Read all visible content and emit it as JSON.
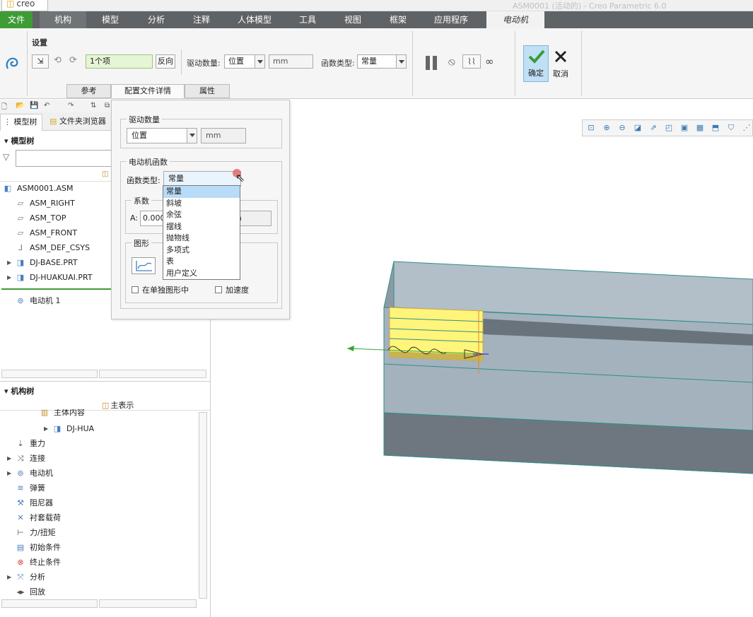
{
  "window": {
    "app_logo": "creo",
    "title": "ASM0001 (活动的) - Creo Parametric 6.0"
  },
  "menu": {
    "file": "文件",
    "items": [
      "机构",
      "模型",
      "分析",
      "注释",
      "人体模型",
      "工具",
      "视图",
      "框架",
      "应用程序"
    ],
    "active": "电动机"
  },
  "ribbon": {
    "group_settings": "设置",
    "reference_value": "1个项",
    "flip_button": "反向",
    "drive_qty_label": "驱动数量:",
    "drive_qty_value": "位置",
    "unit_value": "mm",
    "func_type_label": "函数类型:",
    "func_type_value": "常量",
    "ok_label": "确定",
    "cancel_label": "取消",
    "tabs": [
      "参考",
      "配置文件详情",
      "属性"
    ]
  },
  "left_panel": {
    "tab_model_tree": "模型树",
    "tab_folder_browser": "文件夹浏览器",
    "model_tree_title": "模型树",
    "model_tree_items": [
      "ASM0001.ASM",
      "ASM_RIGHT",
      "ASM_TOP",
      "ASM_FRONT",
      "ASM_DEF_CSYS",
      "DJ-BASE.PRT",
      "DJ-HUAKUAI.PRT",
      "电动机 1"
    ],
    "mech_tree_title": "机构树",
    "main_rep": "主表示",
    "mech_items": [
      "主体内容",
      "DJ-HUA",
      "重力",
      "连接",
      "电动机",
      "弹簧",
      "阻尼器",
      "衬套载荷",
      "力/扭矩",
      "初始条件",
      "终止条件",
      "分析",
      "回放"
    ]
  },
  "popup": {
    "drive_qty_group": "驱动数量",
    "drive_qty_value": "位置",
    "drive_qty_unit": "mm",
    "motor_func_group": "电动机函数",
    "func_type_label": "函数类型:",
    "func_type_value": "常量",
    "coeff_group": "系数",
    "coeff_a_label": "A:",
    "coeff_a_value": "0.000",
    "coeff_unit": "n",
    "graph_group": "图形",
    "separate_graph": "在单独图形中",
    "acceleration": "加速度",
    "dropdown_options": [
      "常量",
      "斜坡",
      "余弦",
      "摆线",
      "抛物线",
      "多项式",
      "表",
      "用户定义"
    ]
  },
  "colors": {
    "file_menu": "#3d9c35",
    "menubar": "#5f6366",
    "selection": "#b8dcf7",
    "model_body": "#a8b6c1",
    "highlight_part": "#fff57a"
  }
}
